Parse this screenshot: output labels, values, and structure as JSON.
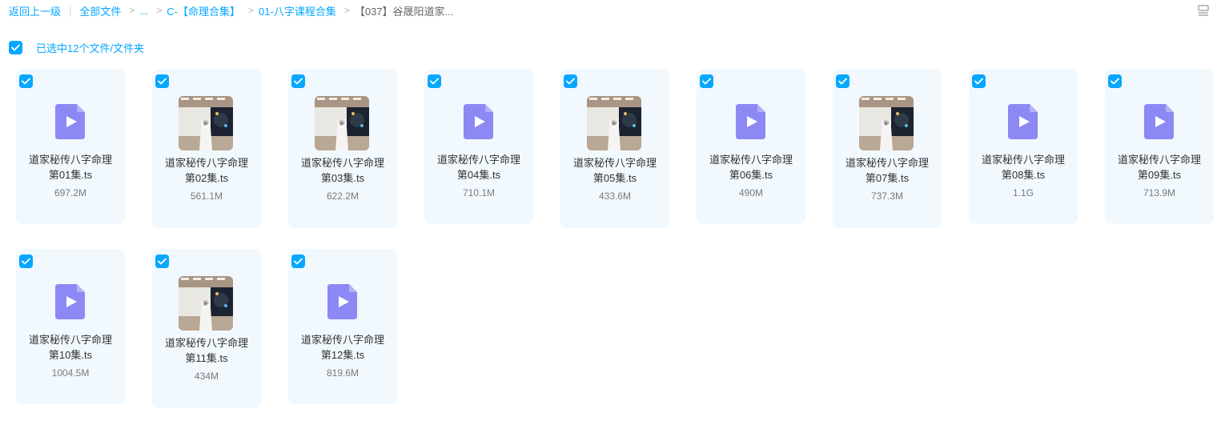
{
  "breadcrumb": {
    "back": "返回上一级",
    "all_files": "全部文件",
    "ellipsis": "...",
    "folder1": "C-【命理合集】",
    "folder2": "01-八字课程合集",
    "current": "【037】谷晟阳道家..."
  },
  "selection": {
    "label": "已选中12个文件/文件夹"
  },
  "files": [
    {
      "line1": "道家秘传八字命理",
      "line2": "第01集.ts",
      "size": "697.2M",
      "thumb": false,
      "icon": "video-file-icon"
    },
    {
      "line1": "道家秘传八字命理",
      "line2": "第02集.ts",
      "size": "561.1M",
      "thumb": true,
      "icon": "video-thumbnail"
    },
    {
      "line1": "道家秘传八字命理",
      "line2": "第03集.ts",
      "size": "622.2M",
      "thumb": true,
      "icon": "video-thumbnail"
    },
    {
      "line1": "道家秘传八字命理",
      "line2": "第04集.ts",
      "size": "710.1M",
      "thumb": false,
      "icon": "video-file-icon"
    },
    {
      "line1": "道家秘传八字命理",
      "line2": "第05集.ts",
      "size": "433.6M",
      "thumb": true,
      "icon": "video-thumbnail"
    },
    {
      "line1": "道家秘传八字命理",
      "line2": "第06集.ts",
      "size": "490M",
      "thumb": false,
      "icon": "video-file-icon"
    },
    {
      "line1": "道家秘传八字命理",
      "line2": "第07集.ts",
      "size": "737.3M",
      "thumb": true,
      "icon": "video-thumbnail"
    },
    {
      "line1": "道家秘传八字命理",
      "line2": "第08集.ts",
      "size": "1.1G",
      "thumb": false,
      "icon": "video-file-icon"
    },
    {
      "line1": "道家秘传八字命理",
      "line2": "第09集.ts",
      "size": "713.9M",
      "thumb": false,
      "icon": "video-file-icon"
    },
    {
      "line1": "道家秘传八字命理",
      "line2": "第10集.ts",
      "size": "1004.5M",
      "thumb": false,
      "icon": "video-file-icon"
    },
    {
      "line1": "道家秘传八字命理",
      "line2": "第11集.ts",
      "size": "434M",
      "thumb": true,
      "icon": "video-thumbnail"
    },
    {
      "line1": "道家秘传八字命理",
      "line2": "第12集.ts",
      "size": "819.6M",
      "thumb": false,
      "icon": "video-file-icon"
    }
  ],
  "colors": {
    "accent": "#06a7ff",
    "card_bg": "#f1f8fe",
    "video_icon": "#8c88f4"
  }
}
